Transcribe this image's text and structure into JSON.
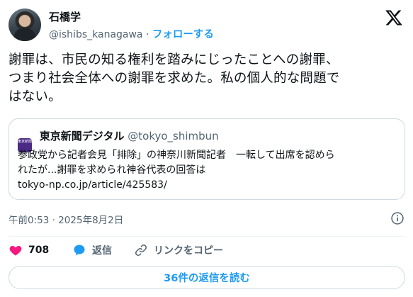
{
  "author": {
    "name": "石橋学",
    "handle": "@ishibs_kanagawa",
    "separator": "·",
    "follow_label": "フォローする"
  },
  "tweet": {
    "lines": [
      "謝罪は、市民の知る権利を踏みにじったことへの謝罪、",
      "つまり社会全体への謝罪を求めた。私の個人的な問題で",
      "はない。"
    ]
  },
  "quote_card": {
    "logo_text": "東京新聞",
    "source_name": "東京新聞デジタル",
    "source_handle": "@tokyo_shimbun",
    "headline_lines": [
      "参政党から記者会見「排除」の神奈川新聞記者　一転して出席を認めら",
      "れたが...謝罪を求められ神谷代表の回答は"
    ],
    "url": "tokyo-np.co.jp/article/425583/"
  },
  "meta": {
    "time": "午前0:53",
    "separator": "·",
    "date": "2025年8月2日"
  },
  "actions": {
    "like_count": "708",
    "reply_label": "返信",
    "copy_link_label": "リンクをコピー"
  },
  "read_replies_label": "36件の返信を読む",
  "colors": {
    "accent": "#1d9bf0",
    "like": "#f91880",
    "text": "#0f1419",
    "muted": "#536471"
  },
  "icons": [
    "x-logo-icon",
    "info-icon",
    "heart-icon",
    "reply-bubble-icon",
    "link-icon"
  ]
}
